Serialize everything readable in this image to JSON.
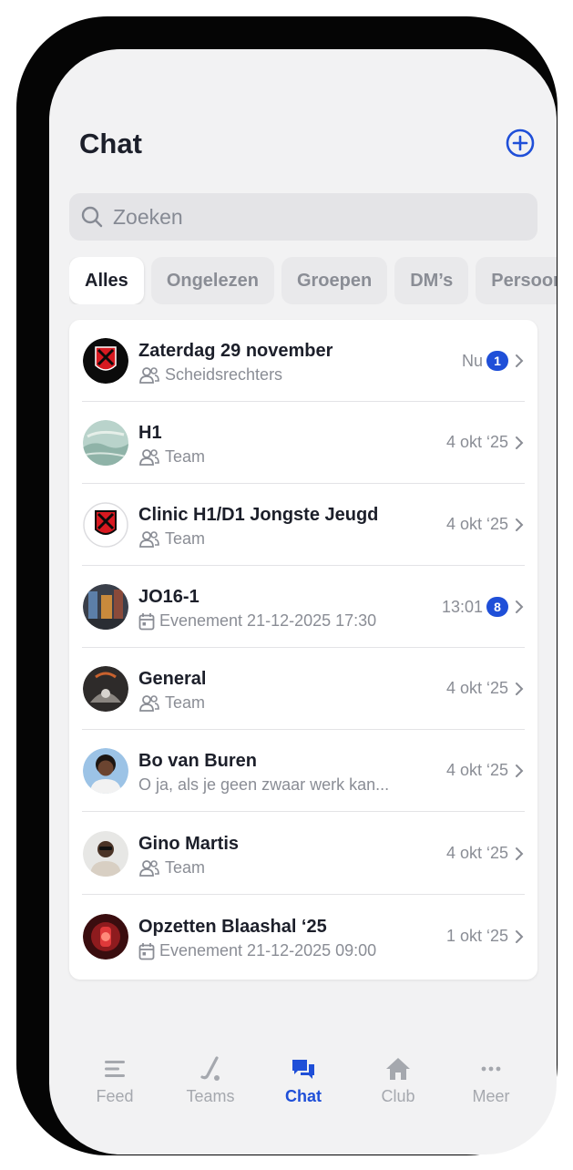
{
  "header": {
    "title": "Chat",
    "add_icon": "plus-circle-icon"
  },
  "search": {
    "placeholder": "Zoeken"
  },
  "filters": [
    "Alles",
    "Ongelezen",
    "Groepen",
    "DM’s",
    "Persoonlijk"
  ],
  "active_filter": "Alles",
  "conversations": [
    {
      "title": "Zaterdag 29 november",
      "subtitle": "Scheidsrechters",
      "subtitle_icon": "people-icon",
      "time": "Nu",
      "unread": "1",
      "avatar": "club-logo"
    },
    {
      "title": "H1",
      "subtitle": "Team",
      "subtitle_icon": "people-icon",
      "time": "4 okt ‘25",
      "unread": "",
      "avatar": "team-photo"
    },
    {
      "title": "Clinic H1/D1 Jongste Jeugd",
      "subtitle": "Team",
      "subtitle_icon": "people-icon",
      "time": "4 okt ‘25",
      "unread": "",
      "avatar": "club-logo"
    },
    {
      "title": "JO16-1",
      "subtitle": "Evenement 21-12-2025 17:30",
      "subtitle_icon": "calendar-icon",
      "time": "13:01",
      "unread": "8",
      "avatar": "event-photo"
    },
    {
      "title": "General",
      "subtitle": "Team",
      "subtitle_icon": "people-icon",
      "time": "4 okt ‘25",
      "unread": "",
      "avatar": "team-photo"
    },
    {
      "title": "Bo van Buren",
      "subtitle": "O ja, als je geen zwaar werk kan...",
      "subtitle_icon": "",
      "time": "4 okt ‘25",
      "unread": "",
      "avatar": "user-photo"
    },
    {
      "title": "Gino Martis",
      "subtitle": "Team",
      "subtitle_icon": "people-icon",
      "time": "4 okt ‘25",
      "unread": "",
      "avatar": "user-photo"
    },
    {
      "title": "Opzetten Blaashal ‘25",
      "subtitle": "Evenement 21-12-2025 09:00",
      "subtitle_icon": "calendar-icon",
      "time": "1 okt ‘25",
      "unread": "",
      "avatar": "event-photo"
    }
  ],
  "nav": [
    {
      "label": "Feed",
      "icon": "feed-icon"
    },
    {
      "label": "Teams",
      "icon": "hockey-stick-icon"
    },
    {
      "label": "Chat",
      "icon": "chat-bubbles-icon"
    },
    {
      "label": "Club",
      "icon": "home-icon"
    },
    {
      "label": "Meer",
      "icon": "more-dots-icon"
    }
  ],
  "active_nav": "Chat",
  "colors": {
    "accent": "#1f4fd8",
    "background": "#f2f2f3",
    "muted": "#8a8d95"
  }
}
